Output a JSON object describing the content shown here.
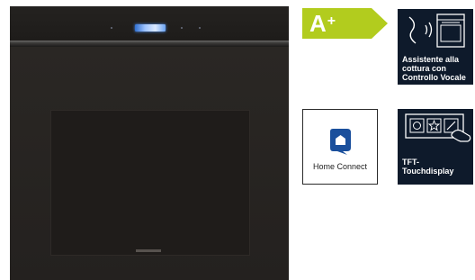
{
  "energy": {
    "class": "A",
    "plus": "+",
    "color": "#b2cc1e"
  },
  "badges": {
    "voice": {
      "line1": "Assistente alla",
      "line2": "cottura con",
      "line3": "Controllo Vocale"
    },
    "home_connect": {
      "label": "Home Connect",
      "color": "#1a4f9c"
    },
    "tft": {
      "line1": "TFT-",
      "line2": "Touchdisplay"
    }
  },
  "icons": {
    "voice": "voice-oven-icon",
    "home_connect": "home-connect-logo-icon",
    "tft": "touchscreen-hand-icon"
  }
}
